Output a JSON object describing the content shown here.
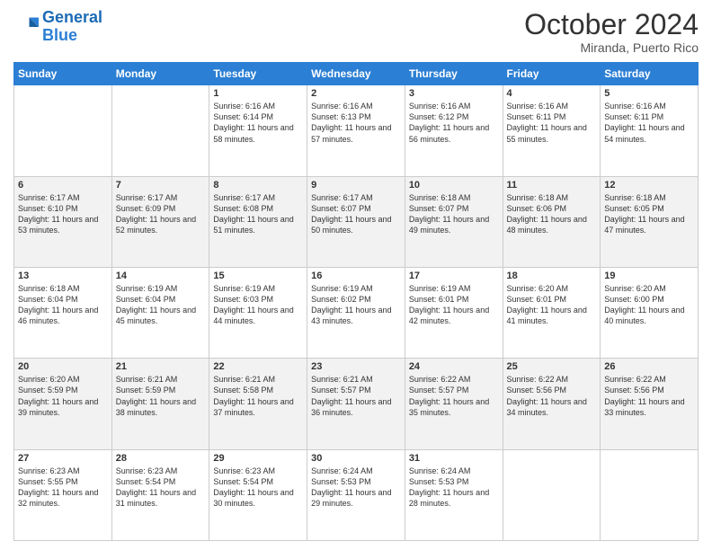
{
  "header": {
    "logo_line1": "General",
    "logo_line2": "Blue",
    "month": "October 2024",
    "location": "Miranda, Puerto Rico"
  },
  "days_of_week": [
    "Sunday",
    "Monday",
    "Tuesday",
    "Wednesday",
    "Thursday",
    "Friday",
    "Saturday"
  ],
  "weeks": [
    [
      {
        "day": "",
        "text": ""
      },
      {
        "day": "",
        "text": ""
      },
      {
        "day": "1",
        "text": "Sunrise: 6:16 AM\nSunset: 6:14 PM\nDaylight: 11 hours and 58 minutes."
      },
      {
        "day": "2",
        "text": "Sunrise: 6:16 AM\nSunset: 6:13 PM\nDaylight: 11 hours and 57 minutes."
      },
      {
        "day": "3",
        "text": "Sunrise: 6:16 AM\nSunset: 6:12 PM\nDaylight: 11 hours and 56 minutes."
      },
      {
        "day": "4",
        "text": "Sunrise: 6:16 AM\nSunset: 6:11 PM\nDaylight: 11 hours and 55 minutes."
      },
      {
        "day": "5",
        "text": "Sunrise: 6:16 AM\nSunset: 6:11 PM\nDaylight: 11 hours and 54 minutes."
      }
    ],
    [
      {
        "day": "6",
        "text": "Sunrise: 6:17 AM\nSunset: 6:10 PM\nDaylight: 11 hours and 53 minutes."
      },
      {
        "day": "7",
        "text": "Sunrise: 6:17 AM\nSunset: 6:09 PM\nDaylight: 11 hours and 52 minutes."
      },
      {
        "day": "8",
        "text": "Sunrise: 6:17 AM\nSunset: 6:08 PM\nDaylight: 11 hours and 51 minutes."
      },
      {
        "day": "9",
        "text": "Sunrise: 6:17 AM\nSunset: 6:07 PM\nDaylight: 11 hours and 50 minutes."
      },
      {
        "day": "10",
        "text": "Sunrise: 6:18 AM\nSunset: 6:07 PM\nDaylight: 11 hours and 49 minutes."
      },
      {
        "day": "11",
        "text": "Sunrise: 6:18 AM\nSunset: 6:06 PM\nDaylight: 11 hours and 48 minutes."
      },
      {
        "day": "12",
        "text": "Sunrise: 6:18 AM\nSunset: 6:05 PM\nDaylight: 11 hours and 47 minutes."
      }
    ],
    [
      {
        "day": "13",
        "text": "Sunrise: 6:18 AM\nSunset: 6:04 PM\nDaylight: 11 hours and 46 minutes."
      },
      {
        "day": "14",
        "text": "Sunrise: 6:19 AM\nSunset: 6:04 PM\nDaylight: 11 hours and 45 minutes."
      },
      {
        "day": "15",
        "text": "Sunrise: 6:19 AM\nSunset: 6:03 PM\nDaylight: 11 hours and 44 minutes."
      },
      {
        "day": "16",
        "text": "Sunrise: 6:19 AM\nSunset: 6:02 PM\nDaylight: 11 hours and 43 minutes."
      },
      {
        "day": "17",
        "text": "Sunrise: 6:19 AM\nSunset: 6:01 PM\nDaylight: 11 hours and 42 minutes."
      },
      {
        "day": "18",
        "text": "Sunrise: 6:20 AM\nSunset: 6:01 PM\nDaylight: 11 hours and 41 minutes."
      },
      {
        "day": "19",
        "text": "Sunrise: 6:20 AM\nSunset: 6:00 PM\nDaylight: 11 hours and 40 minutes."
      }
    ],
    [
      {
        "day": "20",
        "text": "Sunrise: 6:20 AM\nSunset: 5:59 PM\nDaylight: 11 hours and 39 minutes."
      },
      {
        "day": "21",
        "text": "Sunrise: 6:21 AM\nSunset: 5:59 PM\nDaylight: 11 hours and 38 minutes."
      },
      {
        "day": "22",
        "text": "Sunrise: 6:21 AM\nSunset: 5:58 PM\nDaylight: 11 hours and 37 minutes."
      },
      {
        "day": "23",
        "text": "Sunrise: 6:21 AM\nSunset: 5:57 PM\nDaylight: 11 hours and 36 minutes."
      },
      {
        "day": "24",
        "text": "Sunrise: 6:22 AM\nSunset: 5:57 PM\nDaylight: 11 hours and 35 minutes."
      },
      {
        "day": "25",
        "text": "Sunrise: 6:22 AM\nSunset: 5:56 PM\nDaylight: 11 hours and 34 minutes."
      },
      {
        "day": "26",
        "text": "Sunrise: 6:22 AM\nSunset: 5:56 PM\nDaylight: 11 hours and 33 minutes."
      }
    ],
    [
      {
        "day": "27",
        "text": "Sunrise: 6:23 AM\nSunset: 5:55 PM\nDaylight: 11 hours and 32 minutes."
      },
      {
        "day": "28",
        "text": "Sunrise: 6:23 AM\nSunset: 5:54 PM\nDaylight: 11 hours and 31 minutes."
      },
      {
        "day": "29",
        "text": "Sunrise: 6:23 AM\nSunset: 5:54 PM\nDaylight: 11 hours and 30 minutes."
      },
      {
        "day": "30",
        "text": "Sunrise: 6:24 AM\nSunset: 5:53 PM\nDaylight: 11 hours and 29 minutes."
      },
      {
        "day": "31",
        "text": "Sunrise: 6:24 AM\nSunset: 5:53 PM\nDaylight: 11 hours and 28 minutes."
      },
      {
        "day": "",
        "text": ""
      },
      {
        "day": "",
        "text": ""
      }
    ]
  ]
}
